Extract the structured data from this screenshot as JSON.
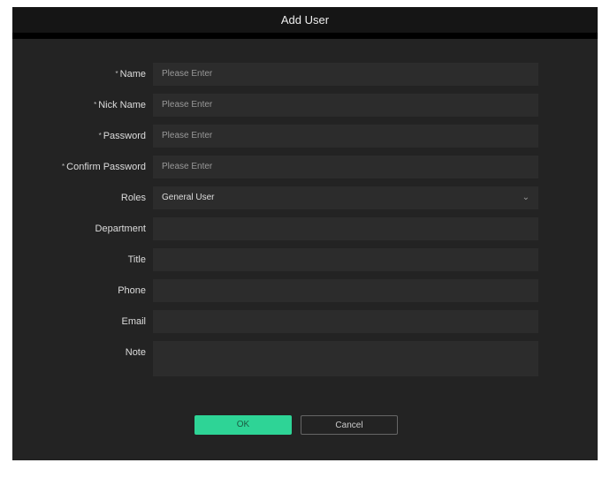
{
  "title": "Add User",
  "fields": [
    {
      "label": "Name",
      "required": true,
      "placeholder": "Please Enter"
    },
    {
      "label": "Nick Name",
      "required": true,
      "placeholder": "Please Enter"
    },
    {
      "label": "Password",
      "required": true,
      "placeholder": "Please Enter"
    },
    {
      "label": "Confirm Password",
      "required": true,
      "placeholder": "Please Enter"
    },
    {
      "label": "Roles",
      "value": "General User"
    },
    {
      "label": "Department"
    },
    {
      "label": "Title"
    },
    {
      "label": "Phone"
    },
    {
      "label": "Email"
    },
    {
      "label": "Note"
    }
  ],
  "req_mark": "*",
  "ok_label": "OK",
  "cancel_label": "Cancel"
}
